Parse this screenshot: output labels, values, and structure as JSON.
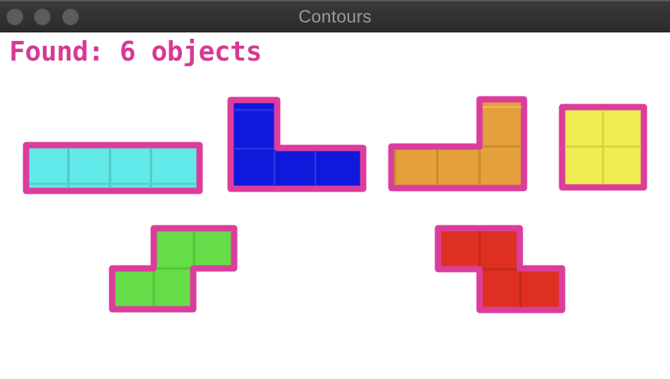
{
  "window": {
    "title": "Contours",
    "traffic_lights": [
      "close-button",
      "minimize-button",
      "zoom-button"
    ]
  },
  "overlay": {
    "found_text": "Found: 6 objects",
    "text_color": "#d63a94"
  },
  "colors": {
    "contour": "#dc3d9c",
    "cyan": "#62e9e9",
    "blue": "#0f19db",
    "orange": "#e3a03c",
    "yellow": "#f1ec52",
    "green": "#64dd48",
    "red": "#dd3022"
  },
  "objects": [
    {
      "name": "I piece",
      "color": "cyan"
    },
    {
      "name": "L piece",
      "color": "blue"
    },
    {
      "name": "J piece",
      "color": "orange"
    },
    {
      "name": "O piece",
      "color": "yellow"
    },
    {
      "name": "S piece",
      "color": "green"
    },
    {
      "name": "Z piece",
      "color": "red"
    }
  ]
}
